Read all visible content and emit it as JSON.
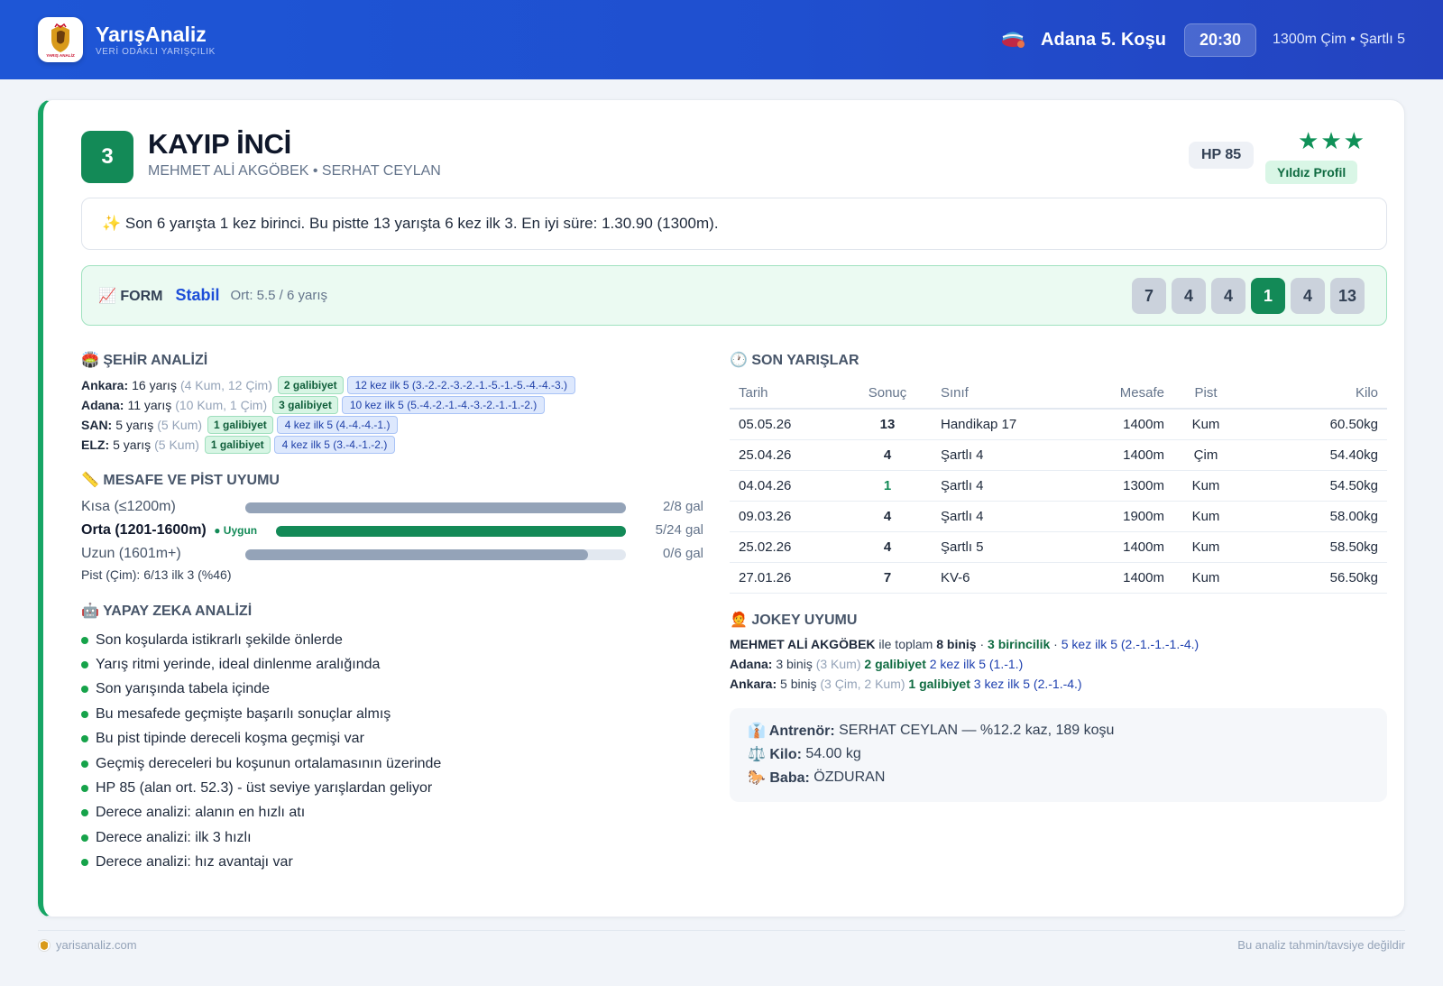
{
  "brand": {
    "title": "YarışAnaliz",
    "subtitle": "VERİ ODAKLI YARIŞÇILIK",
    "logo_text": "YARIŞ ANALİZ"
  },
  "race": {
    "name": "Adana 5. Koşu",
    "time": "20:30",
    "info": "1300m Çim • Şartlı 5"
  },
  "horse": {
    "number": "3",
    "name": "KAYIP İNCİ",
    "jockey_trainer": "MEHMET ALİ AKGÖBEK • SERHAT CEYLAN",
    "hp": "HP 85",
    "stars": "★★★",
    "star_badge": "Yıldız Profil",
    "star_rating": 3
  },
  "summary": "✨ Son 6 yarışta 1 kez birinci. Bu pistte 13 yarışta 6 kez ilk 3. En iyi süre: 1.30.90 (1300m).",
  "form": {
    "label": "📈 FORM",
    "status": "Stabil",
    "avg": "Ort: 5.5 / 6 yarış",
    "results": [
      "7",
      "4",
      "4",
      "1",
      "4",
      "13"
    ]
  },
  "city": {
    "title": "🏟️ ŞEHİR ANALİZİ",
    "rows": [
      {
        "name": "Ankara:",
        "races": "16 yarış",
        "detail": "(4 Kum, 12 Çim)",
        "wins": "2 galibiyet",
        "top5": "12 kez ilk 5 (3.-2.-2.-3.-2.-1.-5.-1.-5.-4.-4.-3.)"
      },
      {
        "name": "Adana:",
        "races": "11 yarış",
        "detail": "(10 Kum, 1 Çim)",
        "wins": "3 galibiyet",
        "top5": "10 kez ilk 5 (5.-4.-2.-1.-4.-3.-2.-1.-1.-2.)"
      },
      {
        "name": "SAN:",
        "races": "5 yarış",
        "detail": "(5 Kum)",
        "wins": "1 galibiyet",
        "top5": "4 kez ilk 5 (4.-4.-4.-1.)"
      },
      {
        "name": "ELZ:",
        "races": "5 yarış",
        "detail": "(5 Kum)",
        "wins": "1 galibiyet",
        "top5": "4 kez ilk 5 (3.-4.-1.-2.)"
      }
    ]
  },
  "distance": {
    "title": "📏 MESAFE VE PİST UYUMU",
    "rows": [
      {
        "label": "Kısa (≤1200m)",
        "value": "2/8 gal",
        "fill": 1.0,
        "color": "#94a3b8"
      },
      {
        "label": "Orta (1201-1600m)",
        "badge": "Uygun",
        "value": "5/24 gal",
        "fill": 1.0,
        "color": "#138a57"
      },
      {
        "label": "Uzun (1601m+)",
        "value": "0/6 gal",
        "fill": 0.9,
        "color": "#94a3b8"
      }
    ],
    "pist": "Pist (Çim): 6/13 ilk 3 (%46)"
  },
  "ai": {
    "title": "🤖 YAPAY ZEKA ANALİZİ",
    "items": [
      "Son koşularda istikrarlı şekilde önlerde",
      "Yarış ritmi yerinde, ideal dinlenme aralığında",
      "Son yarışında tabela içinde",
      "Bu mesafede geçmişte başarılı sonuçlar almış",
      "Bu pist tipinde dereceli koşma geçmişi var",
      "Geçmiş dereceleri bu koşunun ortalamasının üzerinde",
      "HP 85 (alan ort. 52.3) - üst seviye yarışlardan geliyor",
      "Derece analizi: alanın en hızlı atı",
      "Derece analizi: ilk 3 hızlı",
      "Derece analizi: hız avantajı var"
    ]
  },
  "races": {
    "title": "🕐 SON YARIŞLAR",
    "headers": [
      "Tarih",
      "Sonuç",
      "Sınıf",
      "Mesafe",
      "Pist",
      "Kilo"
    ],
    "rows": [
      [
        "05.05.26",
        "13",
        "Handikap 17",
        "1400m",
        "Kum",
        "60.50kg"
      ],
      [
        "25.04.26",
        "4",
        "Şartlı 4",
        "1400m",
        "Çim",
        "54.40kg"
      ],
      [
        "04.04.26",
        "1",
        "Şartlı 4",
        "1300m",
        "Kum",
        "54.50kg"
      ],
      [
        "09.03.26",
        "4",
        "Şartlı 4",
        "1900m",
        "Kum",
        "58.00kg"
      ],
      [
        "25.02.26",
        "4",
        "Şartlı 5",
        "1400m",
        "Kum",
        "58.50kg"
      ],
      [
        "27.01.26",
        "7",
        "KV-6",
        "1400m",
        "Kum",
        "56.50kg"
      ]
    ]
  },
  "jockey": {
    "title": "🧑‍🦰 JOKEY UYUMU",
    "name": "MEHMET ALİ AKGÖBEK",
    "l1_mid": "ile toplam",
    "total": "8 biniş",
    "sep": "·",
    "wins": "3 birincilik",
    "top5": "5 kez ilk 5 (2.-1.-1.-1.-4.)",
    "rows": [
      {
        "name": "Adana:",
        "rides": "3 biniş",
        "detail": "(3 Kum)",
        "wins": "2 galibiyet",
        "top5": "2 kez ilk 5 (1.-1.)"
      },
      {
        "name": "Ankara:",
        "rides": "5 biniş",
        "detail": "(3 Çim, 2 Kum)",
        "wins": "1 galibiyet",
        "top5": "3 kez ilk 5 (2.-1.-4.)"
      }
    ]
  },
  "extra": {
    "trainer_label": "👔 Antrenör:",
    "trainer_value": "SERHAT CEYLAN — %12.2 kaz, 189 koşu",
    "weight_label": "⚖️ Kilo:",
    "weight_value": "54.00 kg",
    "sire_label": "🐎 Baba:",
    "sire_value": "ÖZDURAN"
  },
  "footer": {
    "site": "yarisanaliz.com",
    "disclaimer": "Bu analiz tahmin/tavsiye değildir"
  }
}
